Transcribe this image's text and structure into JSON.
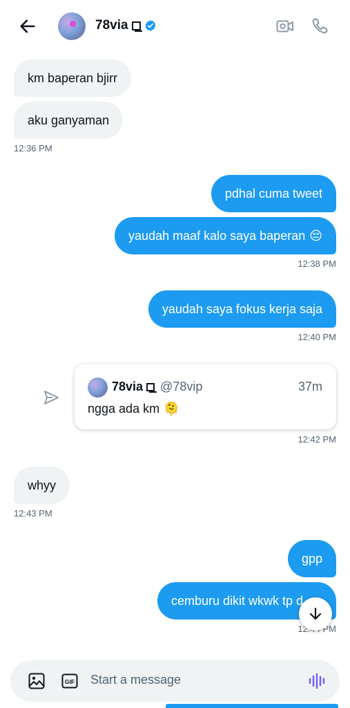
{
  "header": {
    "contact_name": "78via",
    "icons": [
      "back-arrow-icon",
      "verified-badge-icon",
      "video-call-icon",
      "phone-call-icon"
    ]
  },
  "messages": [
    {
      "side": "in",
      "text": "km baperan bjirr"
    },
    {
      "side": "in",
      "text": "aku ganyaman",
      "time": "12:36 PM"
    },
    {
      "side": "out",
      "text": "pdhal cuma tweet"
    },
    {
      "side": "out",
      "text": "yaudah maaf kalo saya baperan",
      "emoji": "😔",
      "time": "12:38 PM"
    },
    {
      "side": "out",
      "text": "yaudah saya fokus kerja saja",
      "time": "12:40 PM"
    },
    {
      "side": "out",
      "text": "gpp"
    },
    {
      "side": "out",
      "text": "cemburu dikit wkwk tp d"
    }
  ],
  "shared_post": {
    "author_name": "78via",
    "author_handle": "@78vip",
    "age": "37m",
    "text": "ngga ada km",
    "emoji": "🫠",
    "time": "12:42 PM"
  },
  "incoming_after": {
    "text": "whyy",
    "time": "12:43 PM"
  },
  "last_time": "12:44 PM",
  "composer": {
    "placeholder": "Start a message",
    "gif_label": "GIF"
  },
  "colors": {
    "accent": "#1d9bf0",
    "incoming_bubble": "#eff3f4",
    "muted_text": "#536471",
    "voice_icon": "#7856ff"
  }
}
